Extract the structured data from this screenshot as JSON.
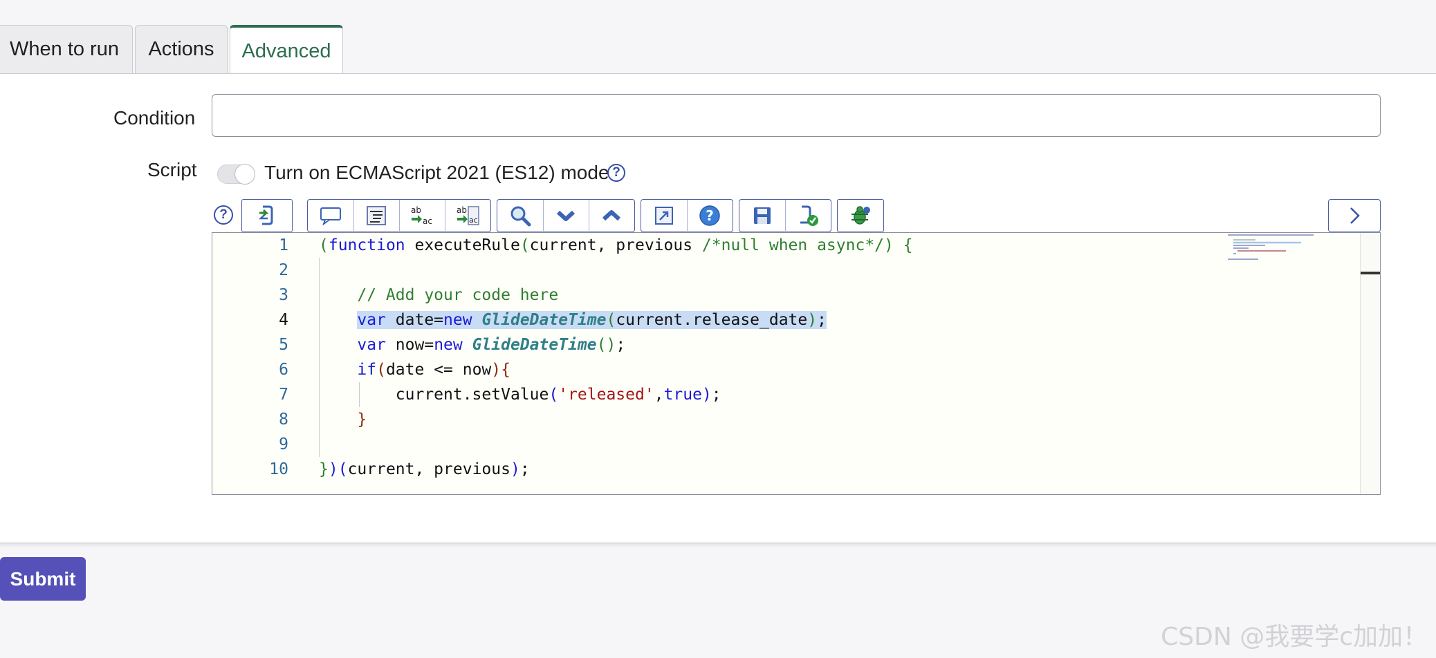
{
  "tabs": [
    {
      "label": "When to run"
    },
    {
      "label": "Actions"
    },
    {
      "label": "Advanced",
      "active": true
    }
  ],
  "form": {
    "condition_label": "Condition",
    "condition_value": "",
    "script_label": "Script",
    "es_mode_label": "Turn on ECMAScript 2021 (ES12) mode",
    "es_mode_enabled": false,
    "help_glyph": "?"
  },
  "toolbar": {
    "buttons": [
      "script-include-icon",
      "comment-icon",
      "format-code-icon",
      "replace-icon",
      "replace-all-icon",
      "search-icon",
      "search-next-icon",
      "search-previous-icon",
      "fullscreen-icon",
      "help-icon",
      "save-icon",
      "validate-icon",
      "debug-icon",
      "expand-icon"
    ]
  },
  "editor": {
    "line_numbers": [
      "1",
      "2",
      "3",
      "4",
      "5",
      "6",
      "7",
      "8",
      "9",
      "10"
    ]
  },
  "submit_label": "Submit",
  "watermark": "CSDN @我要学c加加！",
  "colors": {
    "accent": "#2c6e4f",
    "submit": "#5551b8",
    "toolbar_border": "#4a5a9e"
  }
}
